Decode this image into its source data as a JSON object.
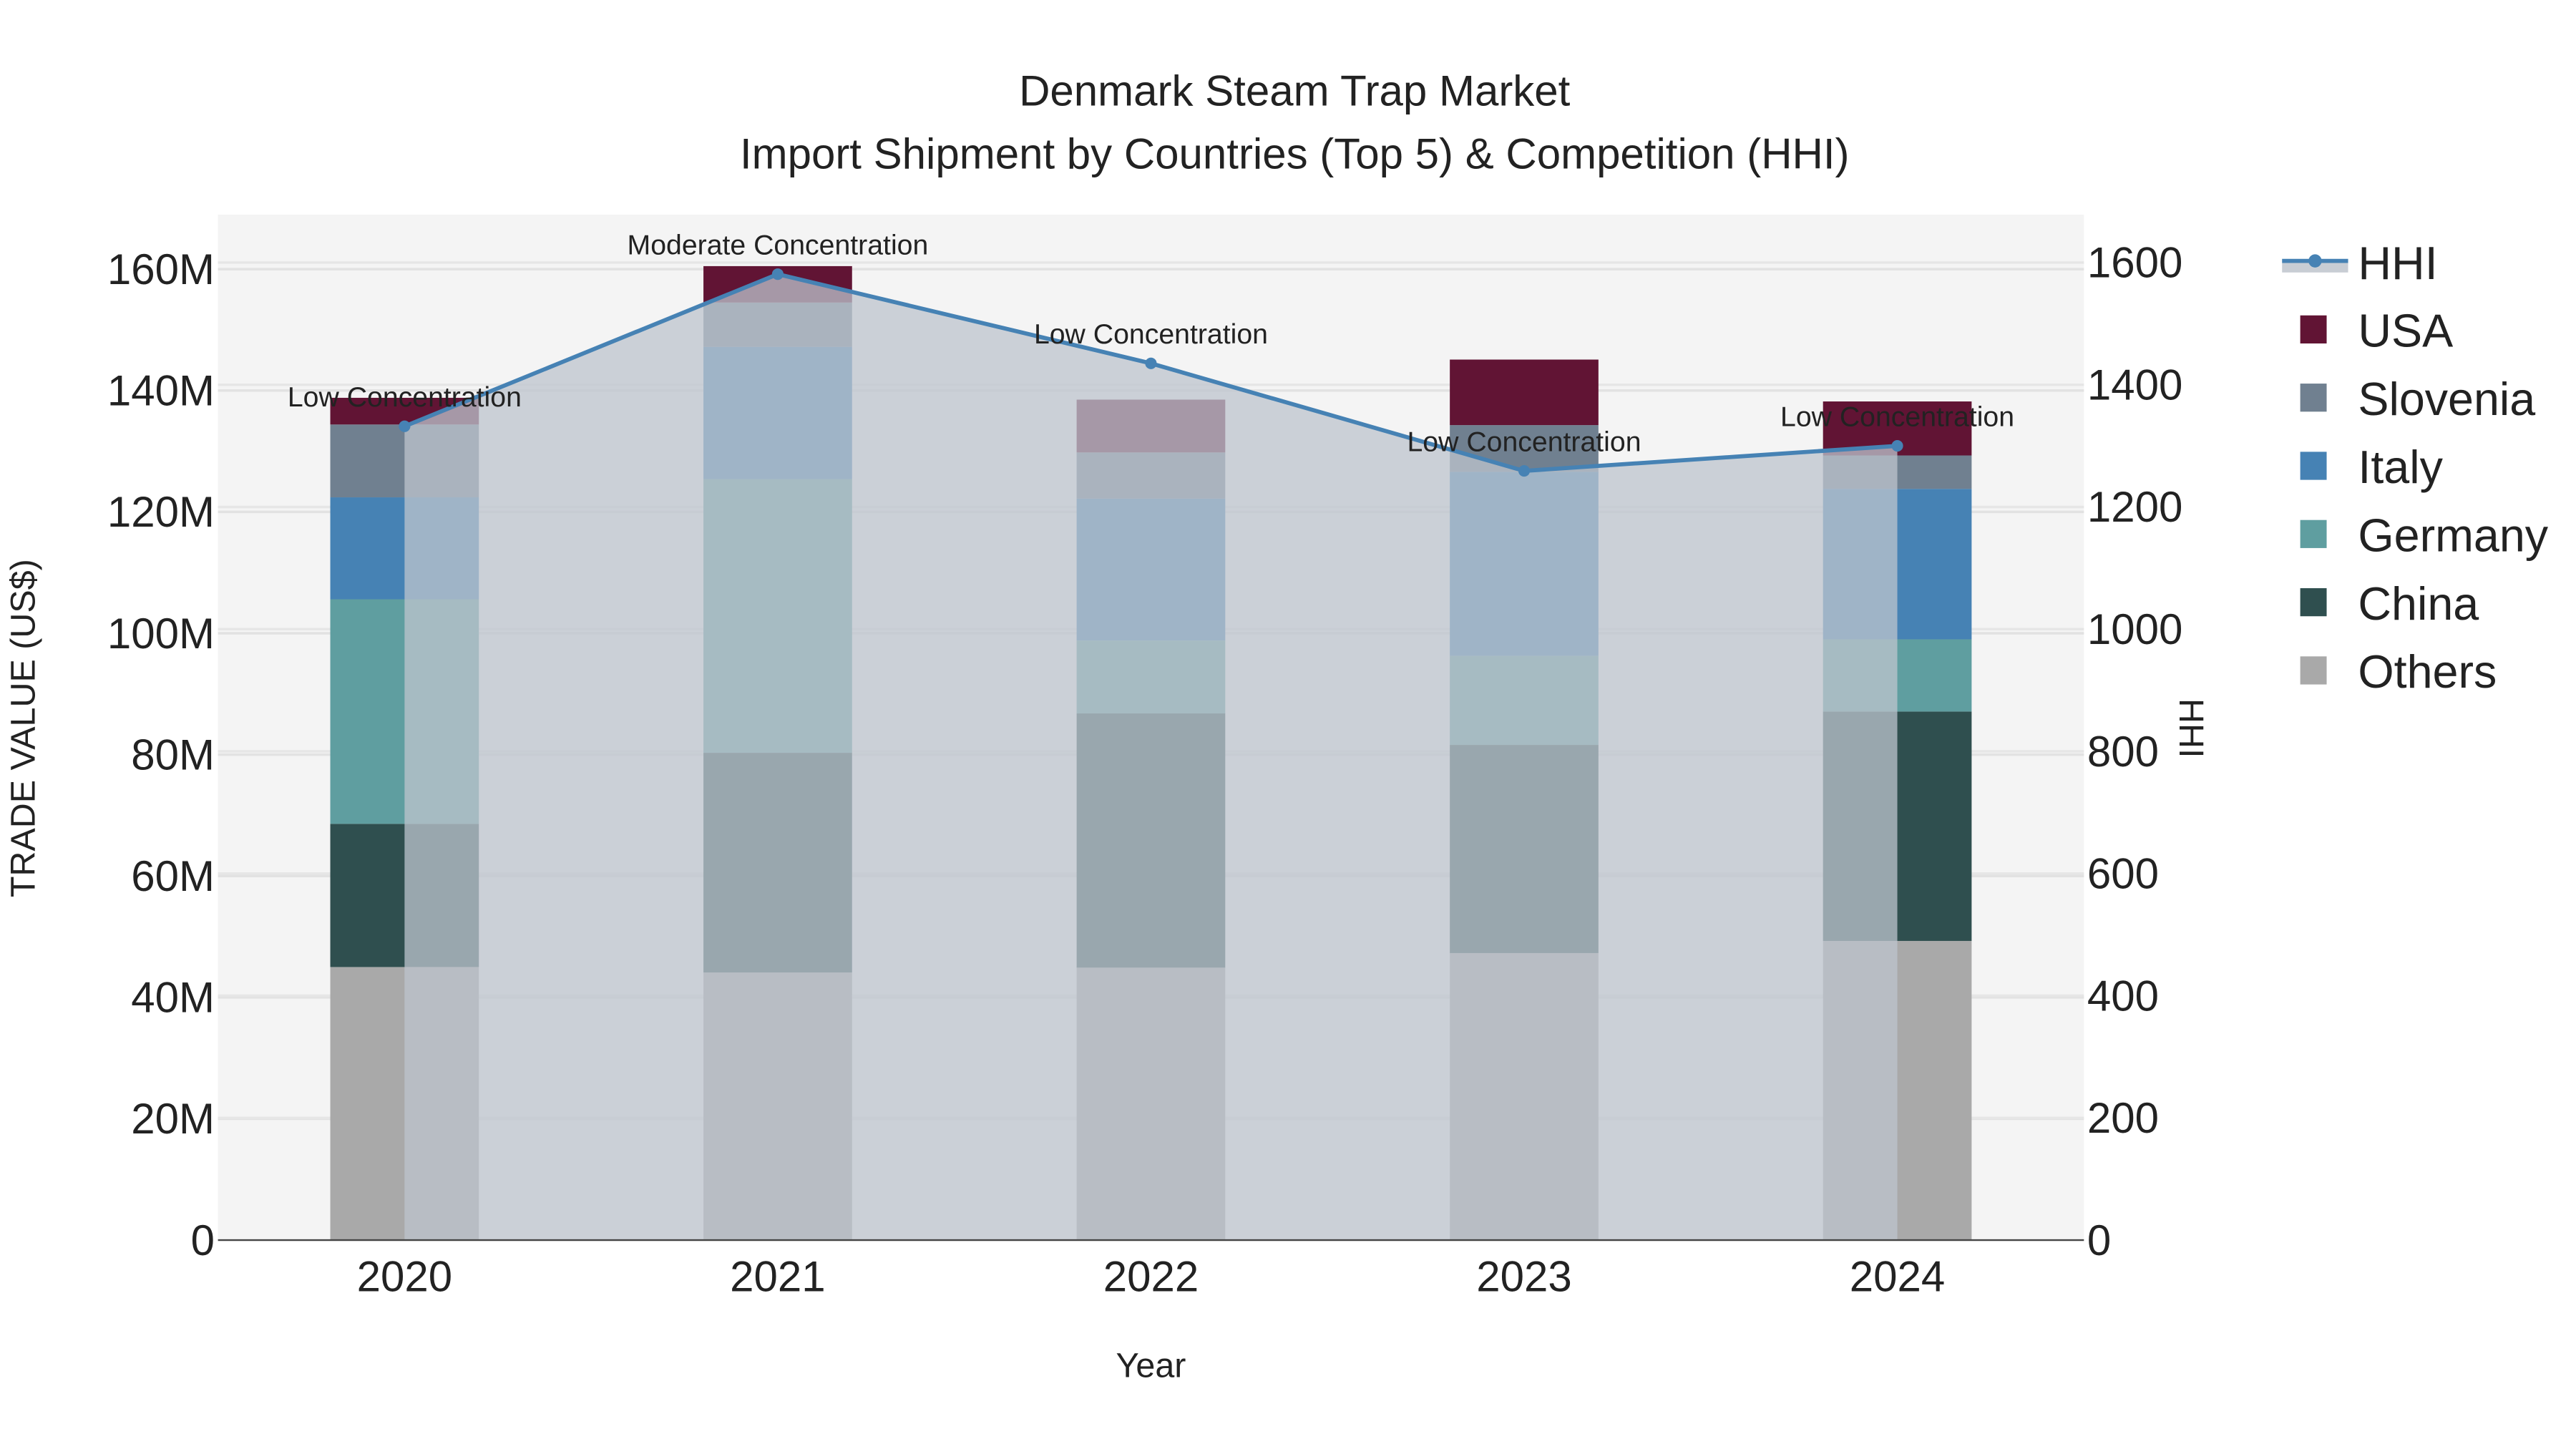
{
  "chart_data": {
    "type": "bar",
    "title": "Denmark Steam Trap Market",
    "subtitle": "Import Shipment by Countries (Top 5) & Competition (HHI)",
    "xlabel": "Year",
    "ylabel": "TRADE VALUE (US$)",
    "y2label": "HHI",
    "categories": [
      "2020",
      "2021",
      "2022",
      "2023",
      "2024"
    ],
    "ylim": [
      0,
      170
    ],
    "y_unit": "M",
    "y_ticks": [
      "0",
      "20M",
      "40M",
      "60M",
      "80M",
      "100M",
      "120M",
      "140M",
      "160M"
    ],
    "y2lim": [
      0,
      1680
    ],
    "y2_ticks": [
      "0",
      "200",
      "400",
      "600",
      "800",
      "1000",
      "1200",
      "1400",
      "1600"
    ],
    "stacked": true,
    "series": [
      {
        "name": "Others",
        "color": "#a9a9a9",
        "values": [
          45.0,
          44.1,
          44.9,
          47.3,
          49.3
        ]
      },
      {
        "name": "China",
        "color": "#2f4f4f",
        "values": [
          23.6,
          36.2,
          41.9,
          34.3,
          37.8
        ]
      },
      {
        "name": "Germany",
        "color": "#5f9ea0",
        "values": [
          37.0,
          45.1,
          12.0,
          14.7,
          11.9
        ]
      },
      {
        "name": "Italy",
        "color": "#4682b4",
        "values": [
          16.8,
          21.8,
          23.4,
          30.3,
          24.8
        ]
      },
      {
        "name": "Slovenia",
        "color": "#708090",
        "values": [
          12.0,
          7.3,
          7.6,
          7.7,
          5.5
        ]
      },
      {
        "name": "USA",
        "color": "#611434",
        "values": [
          4.4,
          6.0,
          8.7,
          10.8,
          8.9
        ]
      }
    ],
    "line": {
      "name": "HHI",
      "color": "#4682b4",
      "fill": "rgba(190,196,206,0.75)",
      "values": [
        1332,
        1581,
        1435,
        1259,
        1300
      ],
      "annotations": [
        "Low Concentration",
        "Moderate Concentration",
        "Low Concentration",
        "Low Concentration",
        "Low Concentration"
      ]
    },
    "legend": [
      "HHI",
      "USA",
      "Slovenia",
      "Italy",
      "Germany",
      "China",
      "Others"
    ],
    "legend_position": "right",
    "grid": true
  }
}
